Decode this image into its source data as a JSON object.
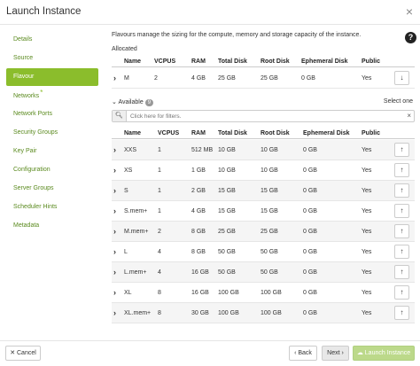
{
  "dialog": {
    "title": "Launch Instance",
    "close": "×"
  },
  "sidebar": {
    "items": [
      {
        "label": "Details"
      },
      {
        "label": "Source"
      },
      {
        "label": "Flavour"
      },
      {
        "label": "Networks"
      },
      {
        "label": "Network Ports"
      },
      {
        "label": "Security Groups"
      },
      {
        "label": "Key Pair"
      },
      {
        "label": "Configuration"
      },
      {
        "label": "Server Groups"
      },
      {
        "label": "Scheduler Hints"
      },
      {
        "label": "Metadata"
      }
    ],
    "required_marker": "*"
  },
  "main": {
    "description": "Flavours manage the sizing for the compute, memory and storage capacity of the instance.",
    "help_icon": "?",
    "allocated_label": "Allocated",
    "allocated_headers": [
      "Name",
      "VCPUS",
      "RAM",
      "Total Disk",
      "Root Disk",
      "Ephemeral Disk",
      "Public"
    ],
    "allocated_row": {
      "name": "M",
      "vcpus": "2",
      "ram": "4 GB",
      "total_disk": "25 GB",
      "root_disk": "25 GB",
      "ephemeral": "0 GB",
      "public": "Yes"
    },
    "available_label": "Available",
    "available_count": "9",
    "select_one": "Select one",
    "filter_placeholder": "Click here for filters.",
    "available_headers": [
      "Name",
      "VCPUS",
      "RAM",
      "Total Disk",
      "Root Disk",
      "Ephemeral Disk",
      "Public"
    ],
    "available_rows": [
      {
        "name": "XXS",
        "vcpus": "1",
        "ram": "512 MB",
        "total_disk": "10 GB",
        "root_disk": "10 GB",
        "ephemeral": "0 GB",
        "public": "Yes"
      },
      {
        "name": "XS",
        "vcpus": "1",
        "ram": "1 GB",
        "total_disk": "10 GB",
        "root_disk": "10 GB",
        "ephemeral": "0 GB",
        "public": "Yes"
      },
      {
        "name": "S",
        "vcpus": "1",
        "ram": "2 GB",
        "total_disk": "15 GB",
        "root_disk": "15 GB",
        "ephemeral": "0 GB",
        "public": "Yes"
      },
      {
        "name": "S.mem+",
        "vcpus": "1",
        "ram": "4 GB",
        "total_disk": "15 GB",
        "root_disk": "15 GB",
        "ephemeral": "0 GB",
        "public": "Yes"
      },
      {
        "name": "M.mem+",
        "vcpus": "2",
        "ram": "8 GB",
        "total_disk": "25 GB",
        "root_disk": "25 GB",
        "ephemeral": "0 GB",
        "public": "Yes"
      },
      {
        "name": "L",
        "vcpus": "4",
        "ram": "8 GB",
        "total_disk": "50 GB",
        "root_disk": "50 GB",
        "ephemeral": "0 GB",
        "public": "Yes"
      },
      {
        "name": "L.mem+",
        "vcpus": "4",
        "ram": "16 GB",
        "total_disk": "50 GB",
        "root_disk": "50 GB",
        "ephemeral": "0 GB",
        "public": "Yes"
      },
      {
        "name": "XL",
        "vcpus": "8",
        "ram": "16 GB",
        "total_disk": "100 GB",
        "root_disk": "100 GB",
        "ephemeral": "0 GB",
        "public": "Yes"
      },
      {
        "name": "XL.mem+",
        "vcpus": "8",
        "ram": "30 GB",
        "total_disk": "100 GB",
        "root_disk": "100 GB",
        "ephemeral": "0 GB",
        "public": "Yes"
      }
    ]
  },
  "footer": {
    "cancel": "✕ Cancel",
    "back": "‹ Back",
    "next": "Next ›",
    "launch": "Launch Instance"
  },
  "colors": {
    "accent": "#8bbd2c",
    "link": "#5a8a1e"
  }
}
